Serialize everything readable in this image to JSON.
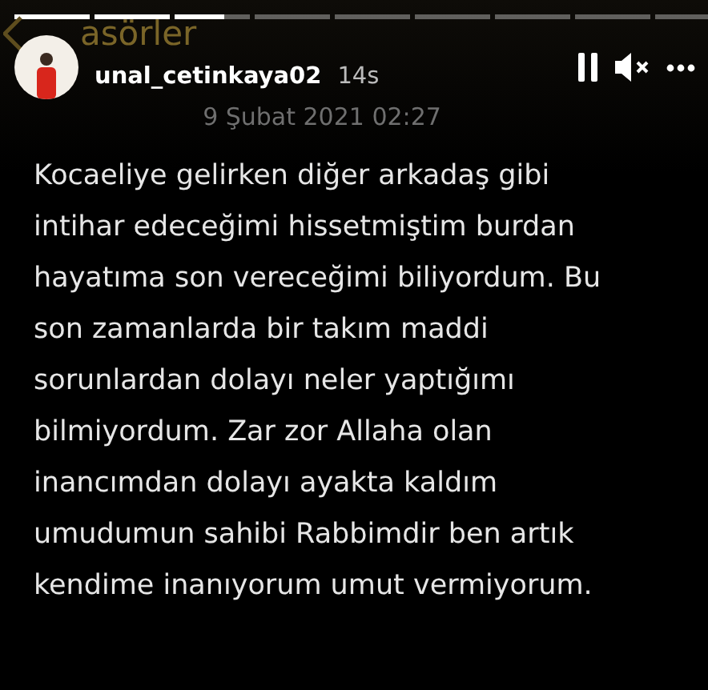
{
  "progress": [
    {
      "kind": "viewed"
    },
    {
      "kind": "viewed"
    },
    {
      "kind": "current",
      "level": 0.65
    },
    {
      "kind": "upcoming"
    },
    {
      "kind": "upcoming"
    },
    {
      "kind": "upcoming"
    },
    {
      "kind": "upcoming"
    },
    {
      "kind": "upcoming"
    },
    {
      "kind": "upcoming"
    }
  ],
  "back_link": {
    "label": "asörler"
  },
  "header": {
    "username": "unal_cetinkaya02",
    "time": "14s",
    "paused": true,
    "muted": true
  },
  "note": {
    "date": "9 Şubat 2021 02:27",
    "lines": [
      "Kocaeliye gelirken diğer arkadaş gibi",
      "intihar edeceğimi hissetmiştim burdan",
      "hayatıma son vereceğimi biliyordum. Bu",
      "son zamanlarda bir takım maddi",
      "sorunlardan dolayı neler yaptığımı",
      "bilmiyordum. Zar zor Allaha olan",
      "inancımdan dolayı ayakta kaldım",
      "umudumun sahibi Rabbimdir ben artık",
      "kendime inanıyorum umut vermiyorum."
    ]
  }
}
